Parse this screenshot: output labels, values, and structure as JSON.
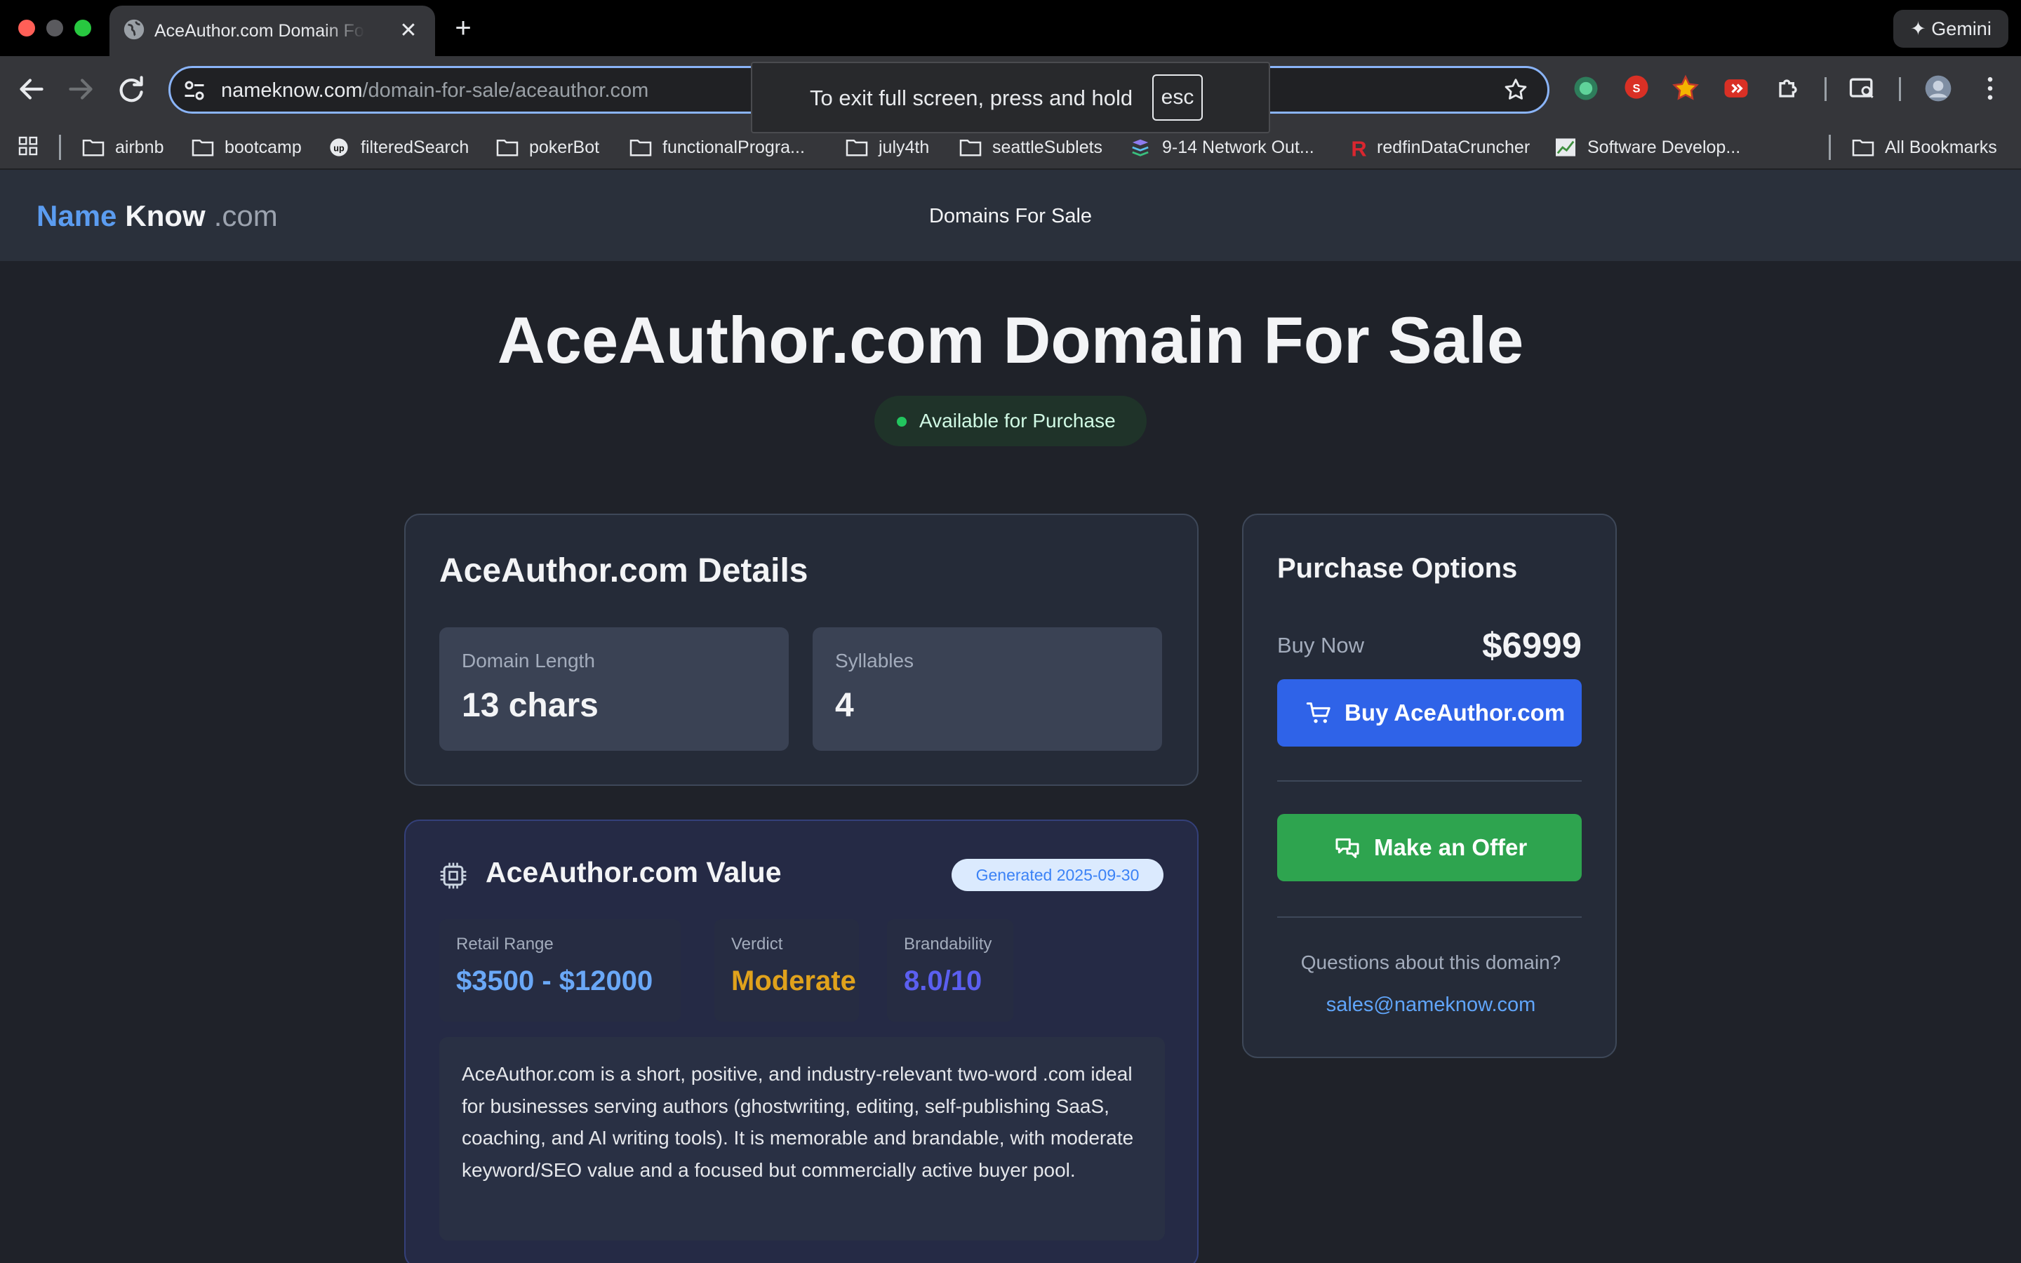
{
  "browser": {
    "tab_title": "AceAuthor.com Domain For Sale",
    "url_host": "nameknow.com",
    "url_path": "/domain-for-sale/aceauthor.com",
    "gemini_label": "Gemini",
    "fullscreen_notice": "To exit full screen, press and hold",
    "fullscreen_key": "esc",
    "bookmarks": [
      {
        "label": "airbnb",
        "icon": "folder-icon"
      },
      {
        "label": "bootcamp",
        "icon": "folder-icon"
      },
      {
        "label": "filteredSearch",
        "icon": "upwork-icon"
      },
      {
        "label": "pokerBot",
        "icon": "folder-icon"
      },
      {
        "label": "functionalProgra...",
        "icon": "folder-icon"
      },
      {
        "label": "july4th",
        "icon": "folder-icon"
      },
      {
        "label": "seattleSublets",
        "icon": "folder-icon"
      },
      {
        "label": "9-14 Network Out...",
        "icon": "layers-icon"
      },
      {
        "label": "redfinDataCruncher",
        "icon": "redfin-icon"
      },
      {
        "label": "Software Develop...",
        "icon": "chart-icon"
      }
    ],
    "all_bookmarks": "All Bookmarks"
  },
  "site": {
    "logo_name": "Name",
    "logo_know": "Know",
    "logo_tld": ".com",
    "nav_domains": "Domains For Sale"
  },
  "page": {
    "title": "AceAuthor.com Domain For Sale",
    "status": "Available for Purchase",
    "status_color": "#22c55e"
  },
  "details": {
    "heading": "AceAuthor.com Details",
    "length_label": "Domain Length",
    "length_value": "13 chars",
    "syllables_label": "Syllables",
    "syllables_value": "4"
  },
  "valuation": {
    "heading": "AceAuthor.com Value",
    "generated": "Generated 2025-09-30",
    "retail_label": "Retail Range",
    "retail_value": "$3500 - $12000",
    "verdict_label": "Verdict",
    "verdict_value": "Moderate",
    "brand_label": "Brandability",
    "brand_value": "8.0/10",
    "description": "AceAuthor.com is a short, positive, and industry-relevant two-word .com ideal for businesses serving authors (ghostwriting, editing, self-publishing SaaS, coaching, and AI writing tools). It is memorable and brandable, with moderate keyword/SEO value and a focused but commercially active buyer pool."
  },
  "purchase": {
    "heading": "Purchase Options",
    "buy_now_label": "Buy Now",
    "price": "$6999",
    "buy_button": "Buy AceAuthor.com",
    "offer_button": "Make an Offer",
    "question": "Questions about this domain?",
    "email": "sales@nameknow.com"
  },
  "colors": {
    "accent_blue": "#2f63e8",
    "offer_green": "#2ea44f",
    "verdict_amber": "#e0a21c",
    "brand_indigo": "#5b5ff0",
    "retail_blue": "#6aa8f7"
  }
}
